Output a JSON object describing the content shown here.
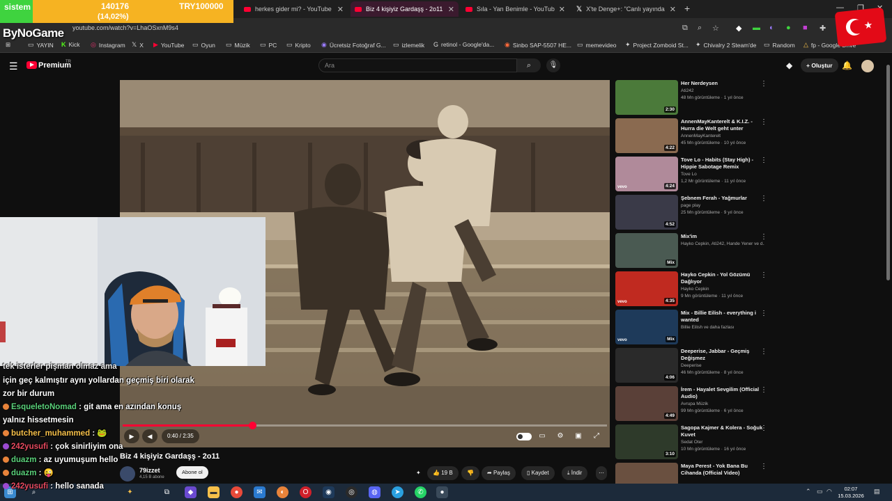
{
  "browser": {
    "tabs": [
      {
        "title": "herkes gider mi? - YouTube",
        "type": "youtube",
        "active": false
      },
      {
        "title": "Biz 4 kişiyiz Gardaşş - 2o11 - Yo",
        "type": "youtube",
        "active": true
      },
      {
        "title": "Sıla - Yan Benimle - YouTube",
        "type": "youtube",
        "active": false
      },
      {
        "title": "X'te Denge+: \"Canlı yayında Ta",
        "type": "x",
        "active": false
      }
    ],
    "url": "youtube.com/watch?v=LhaOSxnM9s4",
    "bookmarks": [
      {
        "label": "YAYIN",
        "icon": "folder"
      },
      {
        "label": "Kick",
        "icon": "K"
      },
      {
        "label": "Instagram",
        "icon": "◎"
      },
      {
        "label": "X",
        "icon": "X"
      },
      {
        "label": "YouTube",
        "icon": "▶"
      },
      {
        "label": "Oyun",
        "icon": "folder"
      },
      {
        "label": "Müzik",
        "icon": "folder"
      },
      {
        "label": "PC",
        "icon": "folder"
      },
      {
        "label": "Kripto",
        "icon": "folder"
      },
      {
        "label": "Ücretsiz Fotoğraf G...",
        "icon": "◉"
      },
      {
        "label": "izlemelik",
        "icon": "folder"
      },
      {
        "label": "retinol - Google'da...",
        "icon": "G"
      },
      {
        "label": "Sinbo SAP-5507 HE...",
        "icon": "◉"
      },
      {
        "label": "memevideo",
        "icon": "folder"
      },
      {
        "label": "Project Zomboid St...",
        "icon": "✦"
      },
      {
        "label": "Chivalry 2 Steam'de",
        "icon": "✦"
      },
      {
        "label": "Random",
        "icon": "folder"
      },
      {
        "label": "fp - Google Drive",
        "icon": "△"
      }
    ]
  },
  "overlay": {
    "system_label": "sistem",
    "amount": "140176",
    "percent": "(14,02%)",
    "goal": "TRY100000",
    "brand": "ByNoGame"
  },
  "youtube": {
    "brand": "Premium",
    "country": "TR",
    "search_placeholder": "Ara",
    "create_label": "Oluştur"
  },
  "player": {
    "time": "0:40 / 2:35",
    "progress": 0.268
  },
  "video": {
    "title": "Biz 4 kişiyiz Gardaşş - 2o11",
    "channel": "79izzet",
    "subscribers": "4,15 B abone",
    "subscribe_label": "Abone ol",
    "likes": "19 B",
    "share_label": "Paylaş",
    "save_label": "Kaydet",
    "download_label": "İndir"
  },
  "chat": [
    {
      "user": "",
      "text": "için geç kalmıştır aynı yollardan geçmiş biri olarak zor bir durum",
      "color": "#5ad07a"
    },
    {
      "user": "EsqueletoNomad",
      "text": ": git ama en azından konuş yalnız hissetmesin",
      "color": "#5ad07a"
    },
    {
      "user": "butcher_muhammed",
      "text": ":",
      "color": "#f6c04a"
    },
    {
      "user": "242yusufi",
      "text": ": çok sinirliyim ona",
      "color": "#e84a5f"
    },
    {
      "user": "duazm",
      "text": ": az uyumuşum hello",
      "color": "#5ad07a"
    },
    {
      "user": "duazm",
      "text": ":",
      "color": "#5ad07a"
    },
    {
      "user": "242yusufi",
      "text": ": hello sanada",
      "color": "#e84a5f"
    }
  ],
  "recommendations": [
    {
      "title": "Her Nerdeysen",
      "channel": "Ati242",
      "meta": "48 Mn görüntüleme · 1 yıl önce",
      "duration": "2:30",
      "thumb": "#4b7a3a",
      "vevo": false
    },
    {
      "title": "AnnenMayKanterelt & K.I.Z. - Hurra die Welt geht unter",
      "channel": "AnnenMayKanterelt",
      "meta": "45 Mn görüntüleme · 10 yıl önce",
      "duration": "4:22",
      "thumb": "#8a6a50",
      "vevo": false
    },
    {
      "title": "Tove Lo - Habits (Stay High) - Hippie Sabotage Remix",
      "channel": "Tove Lo",
      "meta": "1,2 Mr görüntüleme · 11 yıl önce",
      "duration": "4:24",
      "thumb": "#b08a9a",
      "vevo": true
    },
    {
      "title": "Şebnem Ferah - Yağmurlar",
      "channel": "page play",
      "meta": "25 Mn görüntüleme · 9 yıl önce",
      "duration": "4:52",
      "thumb": "#3a3a48",
      "vevo": false
    },
    {
      "title": "Mix'im",
      "channel": "Hayko Cepkin, Ati242, Hande Yener ve d...",
      "meta": "",
      "duration": "Mix",
      "thumb": "#4a5a52",
      "vevo": false
    },
    {
      "title": "Hayko Cepkin - Yol Gözümü Dağlıyor",
      "channel": "Hayko Cepkin",
      "meta": "9 Mn görüntüleme · 11 yıl önce",
      "duration": "4:35",
      "thumb": "#c02a20",
      "vevo": true
    },
    {
      "title": "Mix - Billie Eilish - everything i wanted",
      "channel": "Billie Eilish ve daha fazlası",
      "meta": "",
      "duration": "Mix",
      "thumb": "#1e3a5a",
      "vevo": true
    },
    {
      "title": "Deeperise, Jabbar - Geçmiş Değişmez",
      "channel": "Deeperise",
      "meta": "46 Mn görüntüleme · 8 yıl önce",
      "duration": "4:06",
      "thumb": "#2a2a2a",
      "vevo": false
    },
    {
      "title": "İrem - Hayalet Sevgilim (Official Audio)",
      "channel": "Avrupa Müzik",
      "meta": "99 Mn görüntüleme · 6 yıl önce",
      "duration": "4:49",
      "thumb": "#5a4038",
      "vevo": false
    },
    {
      "title": "Sagopa Kajmer & Kolera - Soğuk Kuvet",
      "channel": "Sedat Oter",
      "meta": "10 Mn görüntüleme · 16 yıl önce",
      "duration": "3:10",
      "thumb": "#2e3a2a",
      "vevo": false
    },
    {
      "title": "Maya Perest - Yok Bana Bu Cihanda (Official Video)",
      "channel": "",
      "meta": "",
      "duration": "",
      "thumb": "#6a5040",
      "vevo": false
    }
  ],
  "taskbar": {
    "time": "02:07",
    "date": "15.03.2026"
  },
  "colors": {
    "youtube_red": "#ff0033",
    "background": "#0f0f0f",
    "overlay_green": "#3fd33f",
    "overlay_orange": "#f6b322"
  }
}
